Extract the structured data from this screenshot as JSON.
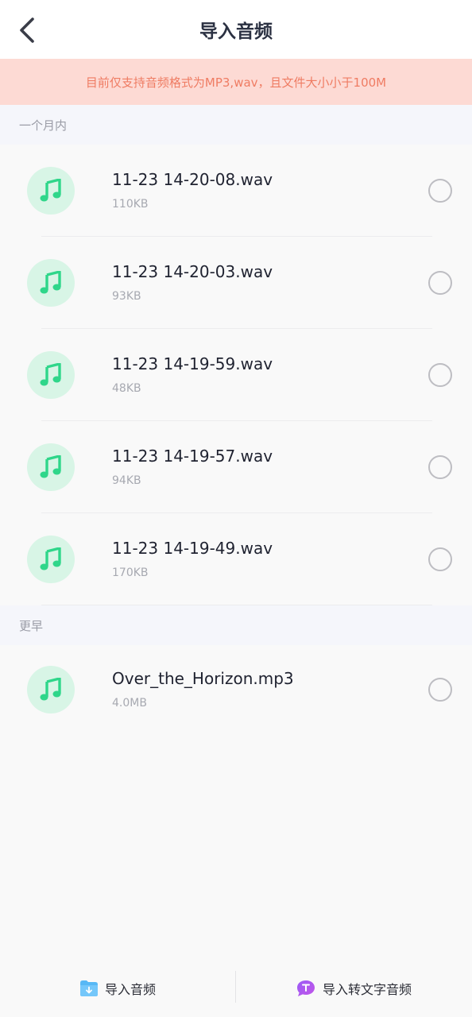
{
  "header": {
    "title": "导入音频",
    "back_icon": "chevron-left-icon"
  },
  "notice": {
    "text": "目前仅支持音频格式为MP3,wav，且文件大小小于100M"
  },
  "sections": [
    {
      "label": "一个月内",
      "files": [
        {
          "name": "11-23 14-20-08.wav",
          "size": "110KB"
        },
        {
          "name": "11-23 14-20-03.wav",
          "size": "93KB"
        },
        {
          "name": "11-23 14-19-59.wav",
          "size": "48KB"
        },
        {
          "name": "11-23 14-19-57.wav",
          "size": "94KB"
        },
        {
          "name": "11-23 14-19-49.wav",
          "size": "170KB"
        }
      ]
    },
    {
      "label": "更早",
      "files": [
        {
          "name": "Over_the_Horizon.mp3",
          "size": "4.0MB"
        }
      ]
    }
  ],
  "bottom_bar": {
    "import_audio_label": "导入音频",
    "import_transcribe_label": "导入转文字音频"
  },
  "colors": {
    "accent_green": "#2fd68a",
    "notice_bg": "#fddad4",
    "notice_text": "#ef7c63"
  }
}
